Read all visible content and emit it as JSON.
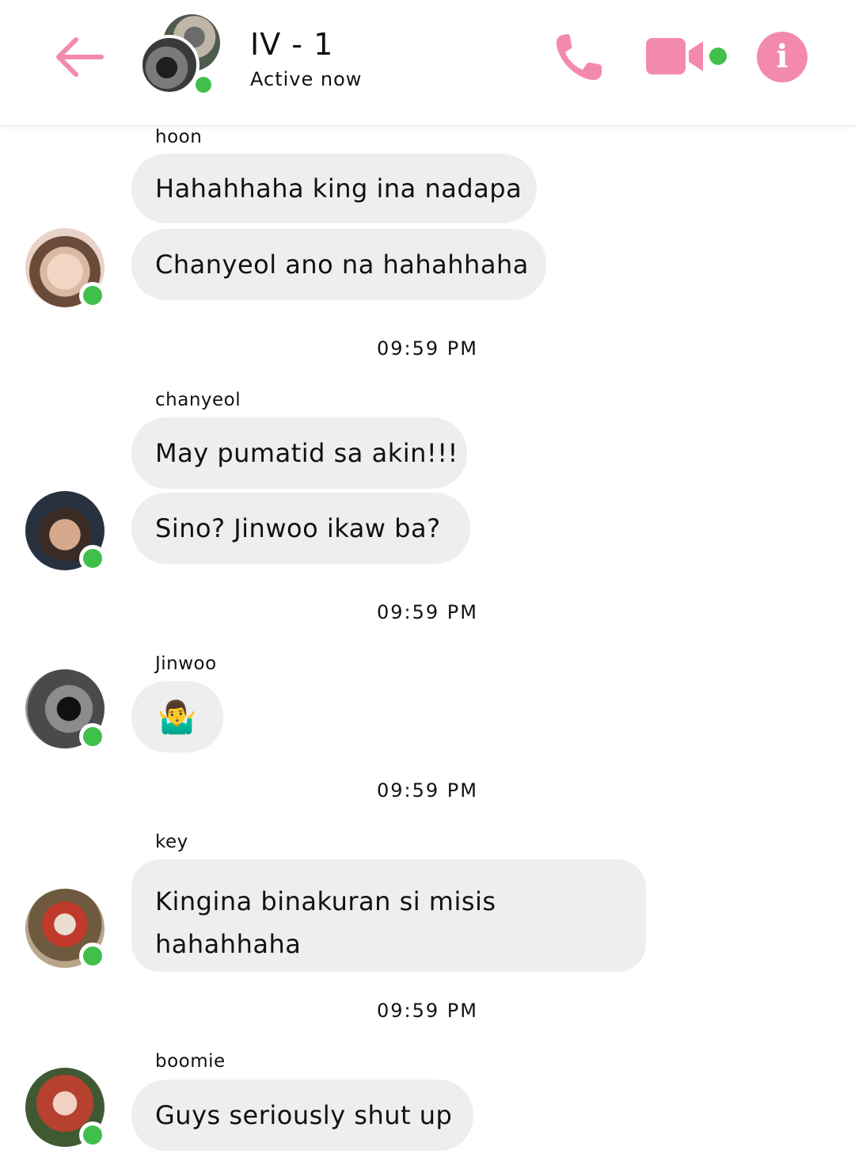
{
  "header": {
    "title": "IV - 1",
    "status": "Active now",
    "accent_color": "#f38aae",
    "online_color": "#40c04a",
    "icons": [
      "back-arrow-icon",
      "phone-icon",
      "video-camera-icon",
      "info-icon"
    ],
    "info_glyph": "i"
  },
  "messages": [
    {
      "sender": "hoon",
      "bubbles": [
        "Hahahhaha king ina nadapa",
        "Chanyeol ano na hahahhaha"
      ]
    },
    {
      "timestamp": "09:59 PM",
      "sender": "chanyeol",
      "bubbles": [
        "May pumatid sa akin!!!",
        "Sino? Jinwoo ikaw ba?"
      ]
    },
    {
      "timestamp": "09:59 PM",
      "sender": "Jinwoo",
      "bubbles": [
        "🤷‍♂️"
      ]
    },
    {
      "timestamp": "09:59 PM",
      "sender": "key",
      "bubbles": [
        "Kingina binakuran si misis hahahhaha"
      ]
    },
    {
      "timestamp": "09:59 PM",
      "sender": "boomie",
      "bubbles": [
        "Guys seriously shut up"
      ]
    }
  ]
}
